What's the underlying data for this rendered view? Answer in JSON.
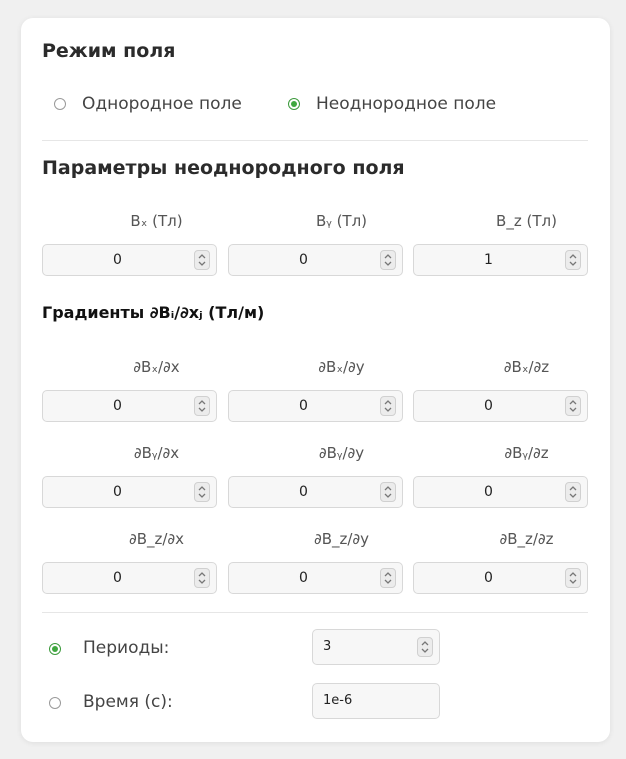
{
  "field_mode": {
    "title": "Режим поля",
    "options": [
      {
        "label": "Однородное поле",
        "selected": false
      },
      {
        "label": "Неоднородное поле",
        "selected": true
      }
    ]
  },
  "params": {
    "title": "Параметры неоднородного поля",
    "fields": [
      {
        "label": "Bₓ (Тл)",
        "value": "0"
      },
      {
        "label": "Bᵧ (Тл)",
        "value": "0"
      },
      {
        "label": "B_z (Тл)",
        "value": "1"
      }
    ]
  },
  "gradients": {
    "title": "Градиенты ∂Bᵢ/∂xⱼ (Тл/м)",
    "rows": [
      [
        {
          "label": "∂Bₓ/∂x",
          "value": "0"
        },
        {
          "label": "∂Bₓ/∂y",
          "value": "0"
        },
        {
          "label": "∂Bₓ/∂z",
          "value": "0"
        }
      ],
      [
        {
          "label": "∂Bᵧ/∂x",
          "value": "0"
        },
        {
          "label": "∂Bᵧ/∂y",
          "value": "0"
        },
        {
          "label": "∂Bᵧ/∂z",
          "value": "0"
        }
      ],
      [
        {
          "label": "∂B_z/∂x",
          "value": "0"
        },
        {
          "label": "∂B_z/∂y",
          "value": "0"
        },
        {
          "label": "∂B_z/∂z",
          "value": "0"
        }
      ]
    ]
  },
  "duration": {
    "periods": {
      "label": "Периоды:",
      "value": "3",
      "selected": true
    },
    "time": {
      "label": "Время (с):",
      "value": "1e-6",
      "selected": false
    }
  },
  "colors": {
    "accent": "#3fa83f",
    "card": "#ffffff",
    "background": "#f0f0f0"
  },
  "icons": {
    "spinner": "up-down-chevrons-icon"
  }
}
